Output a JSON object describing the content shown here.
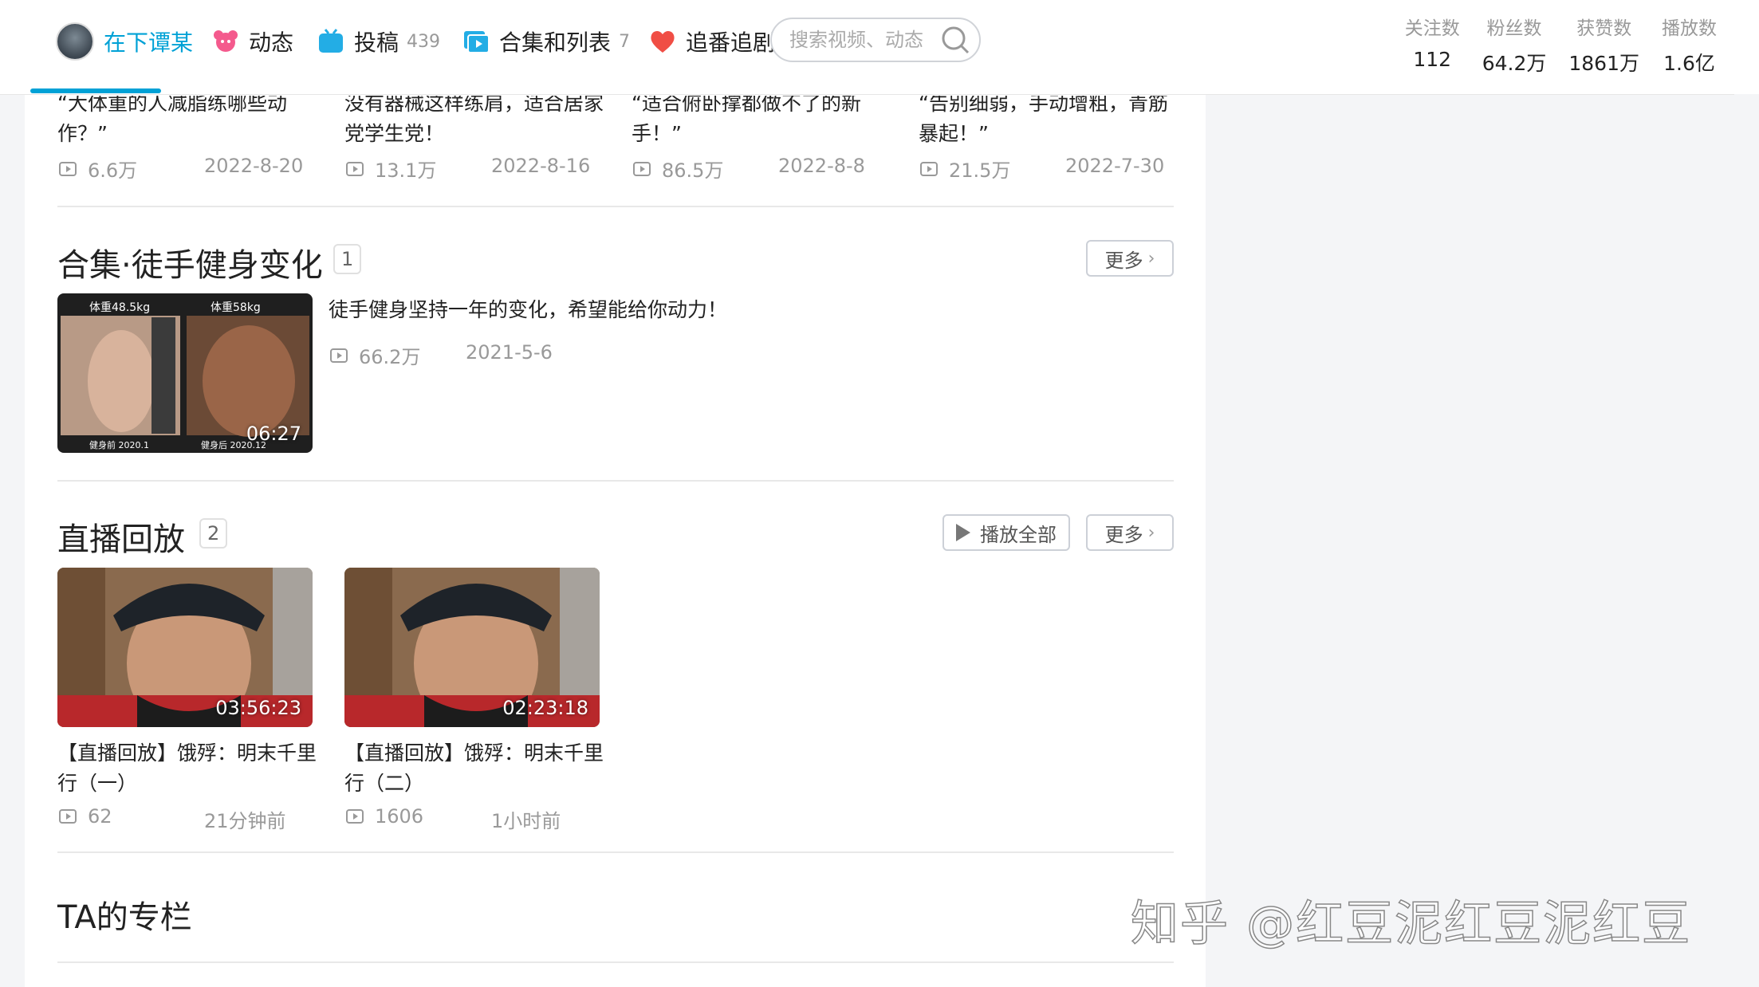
{
  "nav": {
    "user_name": "在下谭某",
    "items": [
      {
        "label": "动态",
        "count": ""
      },
      {
        "label": "投稿",
        "count": "439"
      },
      {
        "label": "合集和列表",
        "count": "7"
      },
      {
        "label": "追番追剧",
        "count": ""
      }
    ],
    "search_placeholder": "搜索视频、动态"
  },
  "stats": [
    {
      "label": "关注数",
      "value": "112"
    },
    {
      "label": "粉丝数",
      "value": "64.2万"
    },
    {
      "label": "获赞数",
      "value": "1861万"
    },
    {
      "label": "播放数",
      "value": "1.6亿"
    }
  ],
  "top_videos": [
    {
      "title_line1": "“大体重的人减脂练哪些动",
      "title_line2": "作？”",
      "views": "6.6万",
      "date": "2022-8-20"
    },
    {
      "title_line1": "没有器械这样练肩，适合居家",
      "title_line2": "党学生党！",
      "views": "13.1万",
      "date": "2022-8-16"
    },
    {
      "title_line1": "“适合俯卧撑都做不了的新",
      "title_line2": "手！”",
      "views": "86.5万",
      "date": "2022-8-8"
    },
    {
      "title_line1": "“告别细弱，手动增粗，青筋",
      "title_line2": "暴起！”",
      "views": "21.5万",
      "date": "2022-7-30"
    }
  ],
  "collection": {
    "title": "合集·徒手健身变化",
    "count": "1",
    "more_label": "更多",
    "video": {
      "title": "徒手健身坚持一年的变化，希望能给你动力！",
      "views": "66.2万",
      "date": "2021-5-6",
      "duration": "06:27",
      "thumb_text_left": "体重48.5kg",
      "thumb_text_right": "体重58kg",
      "thumb_bottom_left": "健身前 2020.1",
      "thumb_bottom_right": "健身后 2020.12"
    }
  },
  "live_replay": {
    "title": "直播回放",
    "count": "2",
    "play_all_label": "播放全部",
    "more_label": "更多",
    "videos": [
      {
        "title_line1": "【直播回放】饿殍：明末千里",
        "title_line2": "行（一）",
        "views": "62",
        "time": "21分钟前",
        "duration": "03:56:23"
      },
      {
        "title_line1": "【直播回放】饿殍：明末千里",
        "title_line2": "行（二）",
        "views": "1606",
        "time": "1小时前",
        "duration": "02:23:18"
      }
    ]
  },
  "column": {
    "title": "TA的专栏"
  },
  "watermark": "知乎 @红豆泥红豆泥红豆",
  "colors": {
    "accent": "#00a1d6",
    "pink": "#f45a8d",
    "heart": "#f04e45"
  }
}
